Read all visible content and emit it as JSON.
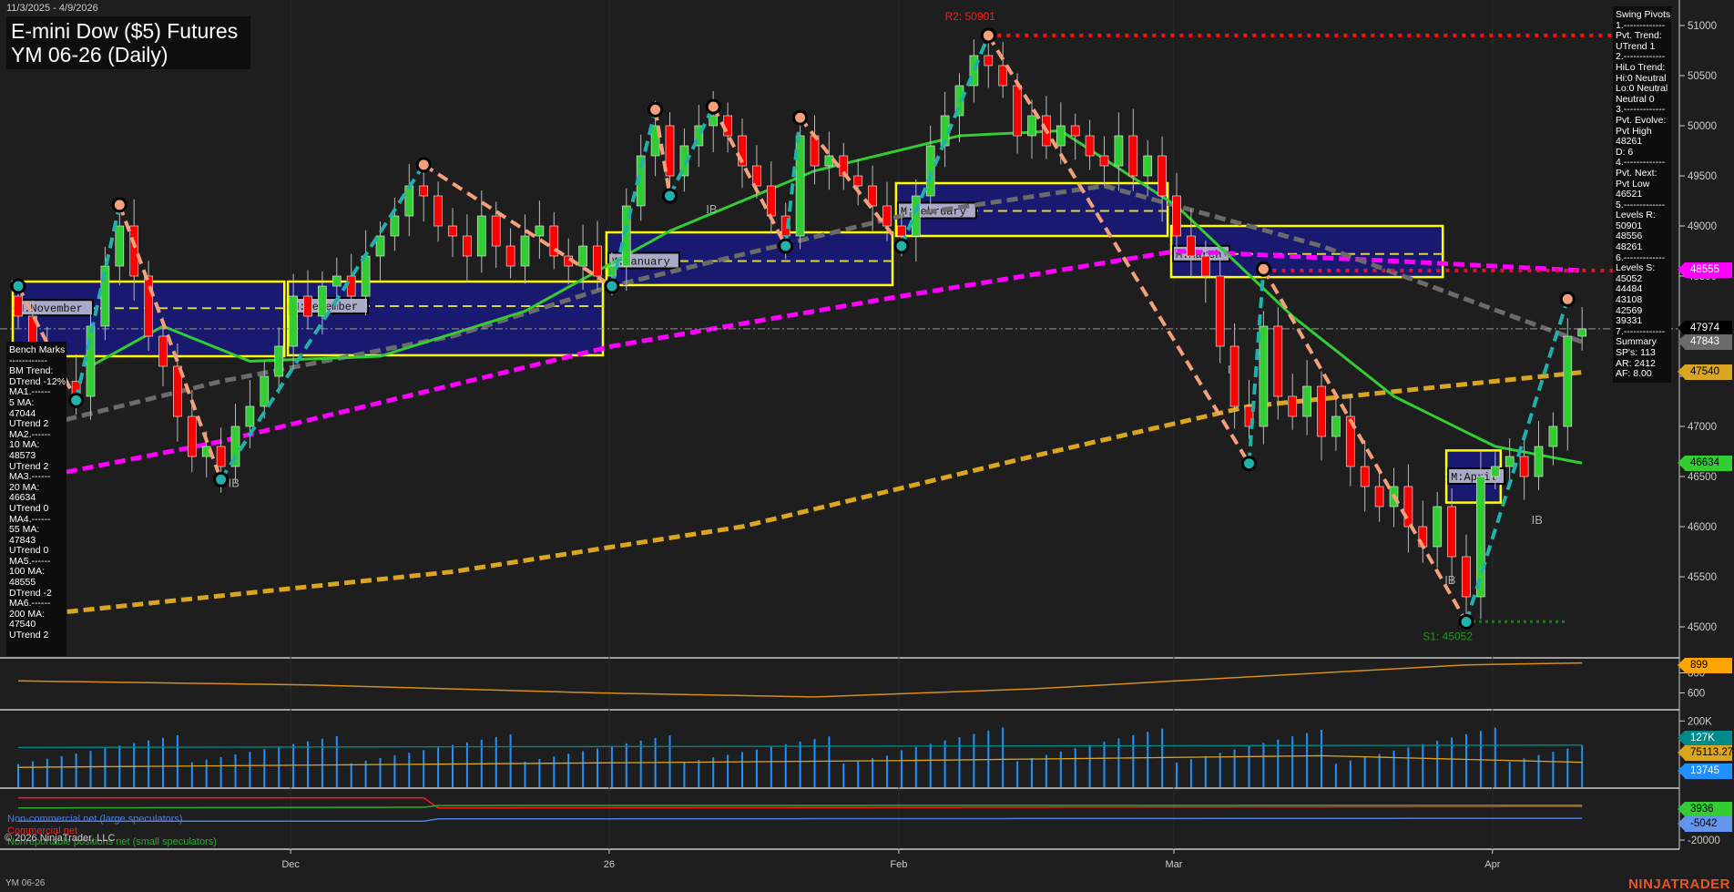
{
  "header": {
    "date_range": "11/3/2025 - 4/9/2026",
    "title_line1": "E-mini Dow ($5) Futures",
    "title_line2": "YM 06-26 (Daily)"
  },
  "swing_pivots_panel": [
    "Swing Pivots",
    "1.-------------",
    "Pvt. Trend:",
    "UTrend 1",
    "2.-------------",
    "HiLo Trend:",
    "Hi:0 Neutral",
    "Lo:0 Neutral",
    "Neutral 0",
    "3.-------------",
    "Pvt. Evolve:",
    "Pvt High",
    "48261",
    "D: 6",
    "4.-------------",
    "Pvt. Next:",
    "Pvt Low",
    "46521",
    "5.-------------",
    "Levels R:",
    "50901",
    "48556",
    "48261",
    "6.-------------",
    "Levels S:",
    "45052",
    "44484",
    "43108",
    "42569",
    "39331",
    "7.-------------",
    "Summary",
    "SP's: 113",
    "AR: 2412",
    "AF: 8.00"
  ],
  "bench_marks_panel": [
    "Bench Marks",
    "------------",
    "BM Trend:",
    "DTrend -12%",
    "MA1.------",
    "5 MA:",
    "47044",
    "UTrend 2",
    "MA2.------",
    "10 MA:",
    "48573",
    "UTrend 2",
    "MA3.------",
    "20 MA:",
    "46634",
    "UTrend 0",
    "MA4.------",
    "55 MA:",
    "47843",
    "UTrend 0",
    "MA5.------",
    "100 MA:",
    "48555",
    "DTrend -2",
    "MA6.------",
    "200 MA:",
    "47540",
    "UTrend 2"
  ],
  "annotations": {
    "r2_label": "R2: 50901",
    "s1_label": "S1: 45052",
    "ib_label": "IB",
    "month_boxes": [
      {
        "label": "M:November",
        "start": 0,
        "end": 18,
        "high": 48445,
        "low": 47700,
        "mid": 48180
      },
      {
        "label": "M:December",
        "start": 19,
        "end": 40,
        "high": 48445,
        "low": 47710,
        "mid": 48200
      },
      {
        "label": "M:January",
        "start": 41,
        "end": 60,
        "high": 48936,
        "low": 48410,
        "mid": 48650
      },
      {
        "label": "M:February",
        "start": 61,
        "end": 79,
        "high": 49427,
        "low": 48900,
        "mid": 49150
      },
      {
        "label": "M:March",
        "start": 80,
        "end": 98,
        "high": 49000,
        "low": 48490,
        "mid": 48720
      },
      {
        "label": "M:April",
        "start": 99,
        "end": 102,
        "high": 46760,
        "low": 46240,
        "mid": 46500
      }
    ]
  },
  "price_tags": [
    {
      "value": "48555",
      "price": 48555,
      "bg": "#ff00ff",
      "fg": "#ffffff"
    },
    {
      "value": "47974",
      "price": 47974,
      "bg": "#000000",
      "fg": "#ffffff"
    },
    {
      "value": "47843",
      "price": 47843,
      "bg": "#6b6b6b",
      "fg": "#ffffff"
    },
    {
      "value": "47540",
      "price": 47540,
      "bg": "#daa520",
      "fg": "#000000"
    },
    {
      "value": "46634",
      "price": 46634,
      "bg": "#32cd32",
      "fg": "#000000"
    }
  ],
  "indicator_tags": [
    {
      "value": "899",
      "panel": 1,
      "bg": "#ffa500",
      "fg": "#000000"
    },
    {
      "value": "127K",
      "panel": 2,
      "bg": "#008b8b",
      "fg": "#ffffff"
    },
    {
      "value": "75113.27",
      "panel": 2,
      "bg": "#daa520",
      "fg": "#000000"
    },
    {
      "value": "13745",
      "panel": 2,
      "bg": "#1e90ff",
      "fg": "#ffffff"
    },
    {
      "value": "3936",
      "panel": 3,
      "bg": "#32cd32",
      "fg": "#000000"
    },
    {
      "value": "-5042",
      "panel": 3,
      "bg": "#6495ed",
      "fg": "#000000"
    }
  ],
  "legend": {
    "noncommercial": "Non-commercial net (large speculators)",
    "commercial": "Commercial net",
    "nonreportable": "Nonreportable positions net (small speculators)"
  },
  "footer": {
    "copyright": "© 2026 NinjaTrader, LLC",
    "symbol": "YM 06-26",
    "logo": "NINJATRADER"
  },
  "chart_data": {
    "type": "candlestick",
    "title": "E-mini Dow ($5) Futures YM 06-26 (Daily)",
    "x_ticks": [
      {
        "label": "Dec",
        "bar": 19
      },
      {
        "label": "26",
        "bar": 41
      },
      {
        "label": "Feb",
        "bar": 61
      },
      {
        "label": "Mar",
        "bar": 80
      },
      {
        "label": "Apr",
        "bar": 102
      }
    ],
    "y_ticks": [
      45000,
      45500,
      46000,
      46500,
      47000,
      47500,
      48000,
      48500,
      49000,
      49500,
      50000,
      50500,
      51000
    ],
    "ylim": [
      44630,
      51200
    ],
    "closes": [
      48100,
      47800,
      47600,
      47450,
      47300,
      48000,
      48600,
      49000,
      48500,
      47900,
      47600,
      47100,
      46700,
      46800,
      46600,
      47000,
      47200,
      47500,
      47800,
      48300,
      48100,
      48400,
      48500,
      48300,
      48700,
      48900,
      49100,
      49400,
      49300,
      49000,
      48900,
      48700,
      49100,
      48800,
      48600,
      48900,
      49000,
      48700,
      48600,
      48800,
      48500,
      48600,
      49200,
      49700,
      50000,
      49500,
      49800,
      50000,
      50100,
      49900,
      49600,
      49400,
      49100,
      48900,
      49900,
      49600,
      49700,
      49500,
      49400,
      49200,
      49000,
      48900,
      49300,
      49800,
      50100,
      50400,
      50700,
      50600,
      50400,
      49900,
      50100,
      49800,
      50000,
      49900,
      49700,
      49600,
      49900,
      49500,
      49700,
      49300,
      48900,
      48700,
      48500,
      47800,
      47200,
      47000,
      48000,
      47300,
      47100,
      47400,
      46900,
      47100,
      46600,
      46400,
      46200,
      46400,
      46000,
      45800,
      46200,
      45700,
      45300,
      46500,
      46600,
      46700,
      46500,
      46800,
      47000,
      47900,
      47974
    ],
    "first_open": 48300,
    "pivots": [
      [
        0,
        48400,
        "L"
      ],
      [
        4,
        47260,
        "L"
      ],
      [
        7,
        49210,
        "H"
      ],
      [
        14,
        46470,
        "L"
      ],
      [
        28,
        49610,
        "H"
      ],
      [
        41,
        48400,
        "L"
      ],
      [
        44,
        50160,
        "H"
      ],
      [
        45,
        49300,
        "L"
      ],
      [
        48,
        50190,
        "H"
      ],
      [
        53,
        48800,
        "L"
      ],
      [
        54,
        50080,
        "H"
      ],
      [
        61,
        48800,
        "L"
      ],
      [
        67,
        50900,
        "H"
      ],
      [
        85,
        46630,
        "L"
      ],
      [
        86,
        48570,
        "H"
      ],
      [
        100,
        45050,
        "L"
      ],
      [
        107,
        48270,
        "H"
      ]
    ],
    "ma55": [
      [
        0,
        46950
      ],
      [
        14,
        47450
      ],
      [
        30,
        47900
      ],
      [
        41,
        48400
      ],
      [
        61,
        49100
      ],
      [
        75,
        49400
      ],
      [
        90,
        48800
      ],
      [
        108,
        47843
      ]
    ],
    "ma100": [
      [
        0,
        46450
      ],
      [
        14,
        46850
      ],
      [
        41,
        47800
      ],
      [
        61,
        48300
      ],
      [
        80,
        48750
      ],
      [
        95,
        48650
      ],
      [
        108,
        48555
      ]
    ],
    "ma200": [
      [
        0,
        45100
      ],
      [
        30,
        45550
      ],
      [
        50,
        46000
      ],
      [
        70,
        46700
      ],
      [
        85,
        47200
      ],
      [
        108,
        47540
      ]
    ],
    "ma20": [
      [
        5,
        47600
      ],
      [
        10,
        48000
      ],
      [
        16,
        47650
      ],
      [
        25,
        47700
      ],
      [
        35,
        48150
      ],
      [
        45,
        48950
      ],
      [
        55,
        49550
      ],
      [
        65,
        49900
      ],
      [
        72,
        49950
      ],
      [
        80,
        49200
      ],
      [
        88,
        48100
      ],
      [
        95,
        47300
      ],
      [
        102,
        46800
      ],
      [
        108,
        46634
      ]
    ],
    "indicator1": {
      "ticks": [
        800,
        600
      ],
      "range": [
        450,
        950
      ],
      "values": [
        [
          0,
          720
        ],
        [
          20,
          680
        ],
        [
          40,
          600
        ],
        [
          55,
          560
        ],
        [
          70,
          640
        ],
        [
          85,
          760
        ],
        [
          100,
          880
        ],
        [
          108,
          899
        ]
      ]
    },
    "indicator2": {
      "ticks": [
        "200K"
      ],
      "range": [
        0,
        220000
      ],
      "bars_seed": 127000,
      "line": [
        [
          0,
          60000
        ],
        [
          30,
          70000
        ],
        [
          60,
          80000
        ],
        [
          90,
          95000
        ],
        [
          108,
          75113
        ]
      ]
    },
    "cot": {
      "range": [
        -25000,
        15000
      ],
      "noncommercial": [
        [
          0,
          -7000
        ],
        [
          28,
          -7000
        ],
        [
          29,
          -5500
        ],
        [
          108,
          -5042
        ]
      ],
      "commercial": [
        [
          0,
          9000
        ],
        [
          28,
          9000
        ],
        [
          29,
          2000
        ],
        [
          108,
          3000
        ]
      ],
      "nonreportable": [
        [
          0,
          2000
        ],
        [
          28,
          2500
        ],
        [
          29,
          3700
        ],
        [
          108,
          3936
        ]
      ]
    }
  }
}
